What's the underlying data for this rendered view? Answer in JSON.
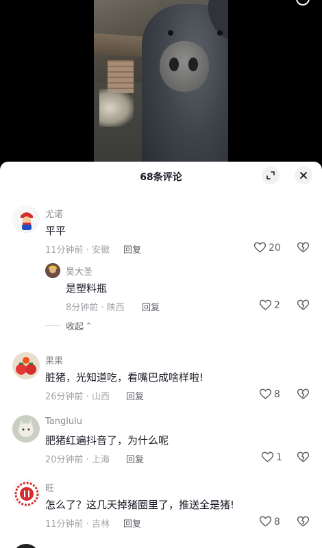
{
  "sheet": {
    "title": "68条评论"
  },
  "comments": [
    {
      "user": "尤诺",
      "text": "平平",
      "time_location": "11分钟前 · 安徽",
      "reply_label": "回复",
      "likes": "20",
      "avatar_color": "#b71c1c"
    },
    {
      "user": "吴大圣",
      "text": "是塑料瓶",
      "time_location": "8分钟前 · 陕西",
      "reply_label": "回复",
      "likes": "2",
      "avatar_color": "#6d4c41"
    },
    {
      "user": "果果",
      "text": "脏猪，光知道吃，看嘴巴成啥样啦!",
      "time_location": "26分钟前 · 山西",
      "reply_label": "回复",
      "likes": "8",
      "avatar_color": "#e53935"
    },
    {
      "user": "Tanglulu",
      "text": "肥猪红遍抖音了，为什么呢",
      "time_location": "20分钟前 · 上海",
      "reply_label": "回复",
      "likes": "1",
      "avatar_color": "#9e9e8c"
    },
    {
      "user": "旺",
      "text": "怎么了？这几天掉猪圈里了，推送全是猪!",
      "time_location": "11分钟前 · 吉林",
      "reply_label": "回复",
      "likes": "8",
      "avatar_color": "#d32f2f"
    }
  ],
  "collapse": {
    "label": "收起",
    "chevron": "⌃"
  },
  "icons": {
    "header_expand": "expand-icon",
    "header_close": "close-icon",
    "like": "heart-icon",
    "dislike": "broken-heart-icon"
  }
}
